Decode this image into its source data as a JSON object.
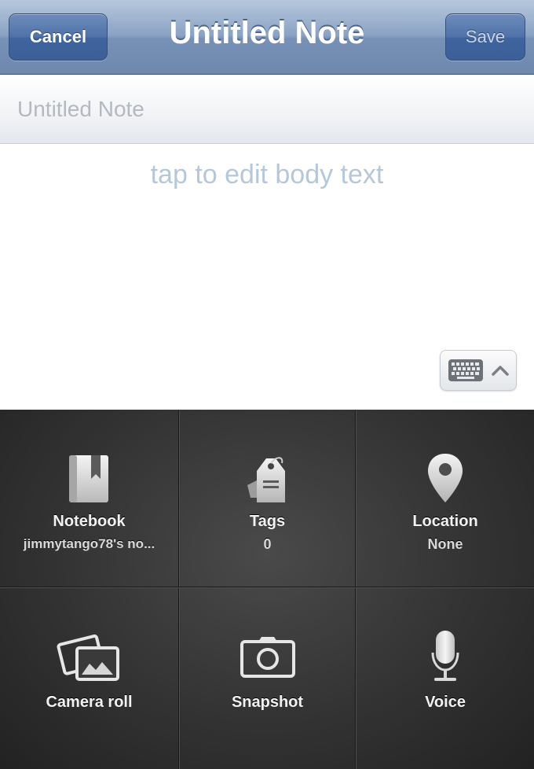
{
  "navbar": {
    "title": "Untitled Note",
    "cancel_label": "Cancel",
    "save_label": "Save"
  },
  "note": {
    "title_placeholder": "Untitled Note",
    "body_placeholder": "tap to edit body text"
  },
  "keyboard_toggle": {
    "icons": [
      "keyboard-icon",
      "chevron-up-icon"
    ]
  },
  "options": [
    {
      "label": "Notebook",
      "value": "jimmytango78's no...",
      "icon": "notebook-icon"
    },
    {
      "label": "Tags",
      "value": "0",
      "icon": "tag-icon"
    },
    {
      "label": "Location",
      "value": "None",
      "icon": "location-pin-icon"
    },
    {
      "label": "Camera roll",
      "icon": "photos-icon"
    },
    {
      "label": "Snapshot",
      "icon": "camera-icon"
    },
    {
      "label": "Voice",
      "icon": "microphone-icon"
    }
  ],
  "colors": {
    "navbar": "#7891b6",
    "placeholder_text": "#b6c7da",
    "grid_background": "#333333",
    "grid_text": "#f2f2f2"
  }
}
